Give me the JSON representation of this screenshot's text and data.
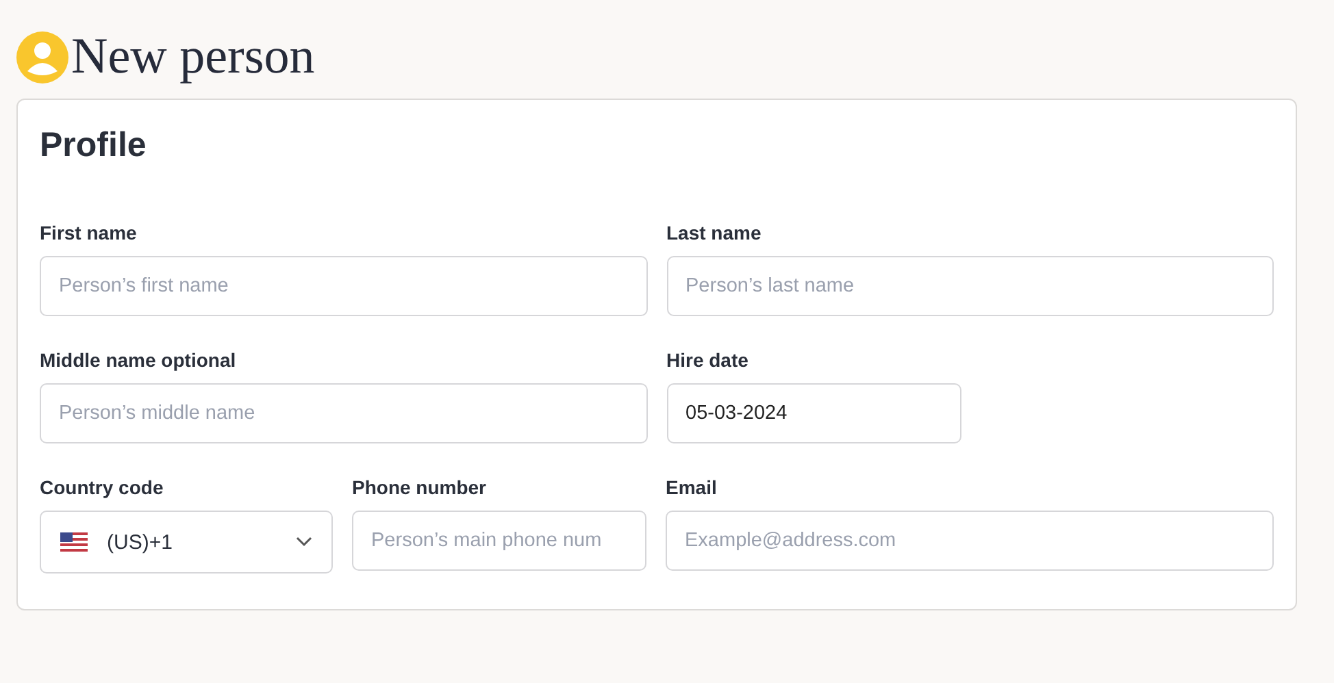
{
  "page": {
    "title": "New person"
  },
  "card": {
    "title": "Profile",
    "rows": [
      [
        {
          "kind": "text",
          "label": "First name",
          "placeholder": "Person’s first name"
        },
        {
          "kind": "text",
          "label": "Last name",
          "placeholder": "Person’s last name"
        }
      ],
      [
        {
          "kind": "text",
          "label": "Middle name optional",
          "placeholder": "Person’s middle name"
        },
        {
          "kind": "date",
          "label": "Hire date",
          "value": "05-03-2024"
        }
      ],
      [
        {
          "kind": "select",
          "label": "Country code",
          "value": "(US)+1"
        },
        {
          "kind": "text",
          "label": "Phone number",
          "placeholder": "Person’s main phone num"
        },
        {
          "kind": "text",
          "label": "Email",
          "placeholder": "Example@address.com"
        }
      ]
    ]
  }
}
